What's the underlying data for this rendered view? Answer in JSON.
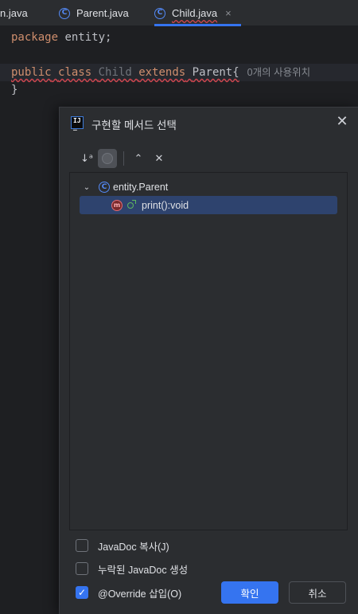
{
  "tabs": [
    {
      "label": "n.java",
      "icon": "none",
      "active": false
    },
    {
      "label": "Parent.java",
      "icon": "class-icon",
      "active": false
    },
    {
      "label": "Child.java",
      "icon": "class-icon",
      "active": true,
      "close": "×"
    }
  ],
  "editor": {
    "line1": {
      "kw": "package",
      "rest": " entity;"
    },
    "line2": {
      "kw1": "public",
      "kw2": "class",
      "name": "Child",
      "kw3": "extends",
      "parent": "Parent{",
      "hint": "0개의 사용위치"
    },
    "line3": "}"
  },
  "dialog": {
    "title": "구현할 메서드 선택",
    "close_glyph": "✕",
    "toolbar": {
      "sort_icon": "sort-alpha-icon",
      "toggle_icon": "show-classes-toggle-icon",
      "expand_icon": "expand-all-icon",
      "collapse_icon": "collapse-all-icon"
    },
    "tree": {
      "group": {
        "label": "entity.Parent",
        "expanded": true
      },
      "method": {
        "label": "print():void",
        "selected": true
      }
    },
    "options": [
      {
        "label": "JavaDoc 복사(J)",
        "checked": false
      },
      {
        "label": "누락된 JavaDoc 생성",
        "checked": false
      },
      {
        "label": "@Override 삽입(O)",
        "checked": true
      }
    ],
    "ok_label": "확인",
    "cancel_label": "취소"
  },
  "colors": {
    "accent": "#3574f0",
    "background": "#1e1f22",
    "panel": "#2b2d30",
    "keyword": "#cf8e6d",
    "selection": "#2e436e"
  }
}
